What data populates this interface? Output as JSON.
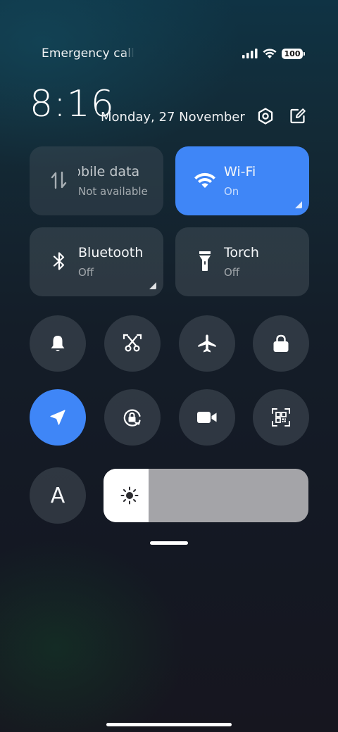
{
  "status_bar": {
    "carrier_text": "Emergency calls",
    "battery_level": "100",
    "signal_icon": "cellular-signal-icon",
    "wifi_icon": "wifi-icon",
    "battery_icon": "battery-icon"
  },
  "header": {
    "time": "8:16",
    "date": "Monday, 27 November",
    "settings_icon": "settings-icon",
    "edit_icon": "edit-icon"
  },
  "tiles": {
    "mobile_data": {
      "title": "Mobile data",
      "status": "Not available",
      "icon": "mobile-data-icon"
    },
    "wifi": {
      "title": "Wi-Fi",
      "status": "On",
      "icon": "wifi-icon"
    },
    "bluetooth": {
      "title": "Bluetooth",
      "status": "Off",
      "icon": "bluetooth-icon"
    },
    "torch": {
      "title": "Torch",
      "status": "Off",
      "icon": "torch-icon"
    }
  },
  "toggles_row1": [
    {
      "name": "silent-mode",
      "icon": "bell-icon",
      "active": false
    },
    {
      "name": "screenshot",
      "icon": "scissors-screenshot-icon",
      "active": false
    },
    {
      "name": "airplane-mode",
      "icon": "airplane-icon",
      "active": false
    },
    {
      "name": "lock-screen",
      "icon": "lock-icon",
      "active": false
    }
  ],
  "toggles_row2": [
    {
      "name": "location",
      "icon": "location-arrow-icon",
      "active": true
    },
    {
      "name": "auto-rotate",
      "icon": "rotation-lock-icon",
      "active": false
    },
    {
      "name": "screen-recorder",
      "icon": "video-camera-icon",
      "active": false
    },
    {
      "name": "scanner",
      "icon": "qr-scanner-icon",
      "active": false
    }
  ],
  "font_button": {
    "label": "A",
    "icon": "font-size-icon"
  },
  "brightness": {
    "level": 0.22,
    "icon": "brightness-sun-icon"
  },
  "colors": {
    "accent": "#3f86f7",
    "tile_bg": "#3c444c",
    "slider_track": "#a4a4a8",
    "slider_fill": "#ffffff"
  }
}
